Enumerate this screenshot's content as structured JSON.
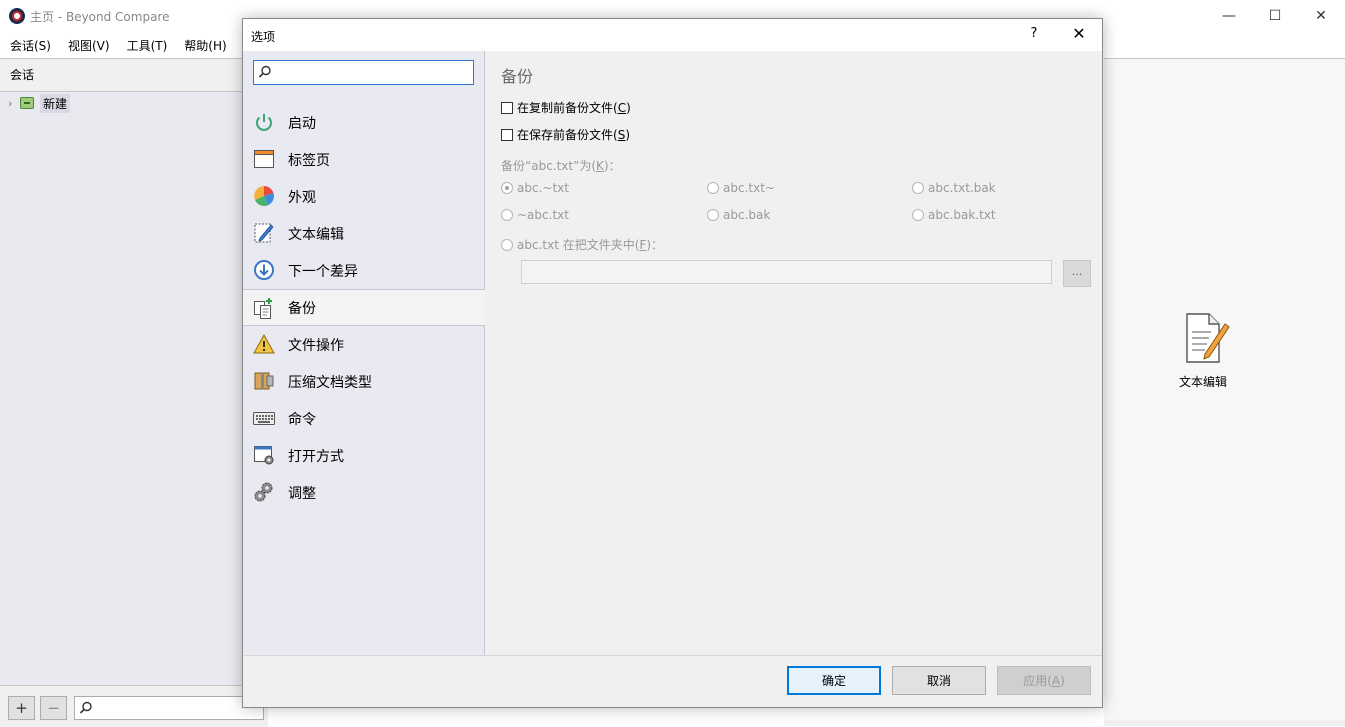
{
  "window": {
    "title": "主页 - Beyond Compare",
    "minimize": "—",
    "maximize": "☐",
    "close": "✕"
  },
  "menu": [
    "会话(S)",
    "视图(V)",
    "工具(T)",
    "帮助(H)"
  ],
  "sessions": {
    "header": "会话",
    "tree_items": [
      {
        "label": "新建"
      }
    ],
    "add_label": "+",
    "remove_label": "−"
  },
  "launcher": {
    "text_edit_label": "文本编辑"
  },
  "dialog": {
    "title": "选项",
    "help_label": "?",
    "close_label": "✕",
    "nav_items": [
      {
        "label": "启动",
        "icon": "power-icon"
      },
      {
        "label": "标签页",
        "icon": "tab-page-icon"
      },
      {
        "label": "外观",
        "icon": "pie-palette-icon"
      },
      {
        "label": "文本编辑",
        "icon": "pencil-document-icon"
      },
      {
        "label": "下一个差异",
        "icon": "down-arrow-circle-icon"
      },
      {
        "label": "备份",
        "icon": "backup-copy-icon",
        "selected": true
      },
      {
        "label": "文件操作",
        "icon": "warning-icon"
      },
      {
        "label": "压缩文档类型",
        "icon": "archive-zipper-icon"
      },
      {
        "label": "命令",
        "icon": "keyboard-icon"
      },
      {
        "label": "打开方式",
        "icon": "window-gear-icon"
      },
      {
        "label": "调整",
        "icon": "gears-icon"
      }
    ],
    "section_title": "备份",
    "checkboxes": [
      {
        "label_prefix": "在复制前备份文件(",
        "hotkey": "C",
        "label_suffix": ")",
        "checked": false
      },
      {
        "label_prefix": "在保存前备份文件(",
        "hotkey": "S",
        "label_suffix": ")",
        "checked": false
      }
    ],
    "backup_as": {
      "prefix": "备份“abc.txt”为(",
      "hotkey": "K",
      "suffix": ")："
    },
    "radio_options": [
      {
        "label": "abc.~txt",
        "selected": true
      },
      {
        "label": "abc.txt~",
        "selected": false
      },
      {
        "label": "abc.txt.bak",
        "selected": false
      },
      {
        "label": "~abc.txt",
        "selected": false
      },
      {
        "label": "abc.bak",
        "selected": false
      },
      {
        "label": "abc.bak.txt",
        "selected": false
      }
    ],
    "folder_option": {
      "prefix": "abc.txt 在把文件夹中(",
      "hotkey": "F",
      "suffix": ")："
    },
    "folder_value": "",
    "browse_label": "...",
    "buttons": {
      "ok": "确定",
      "cancel": "取消",
      "apply_prefix": "应用(",
      "apply_hotkey": "A",
      "apply_suffix": ")"
    },
    "colors": {
      "accent": "#0078d7",
      "nav_bg": "#e9eaf1",
      "content_bg": "#f0f0f0"
    }
  }
}
